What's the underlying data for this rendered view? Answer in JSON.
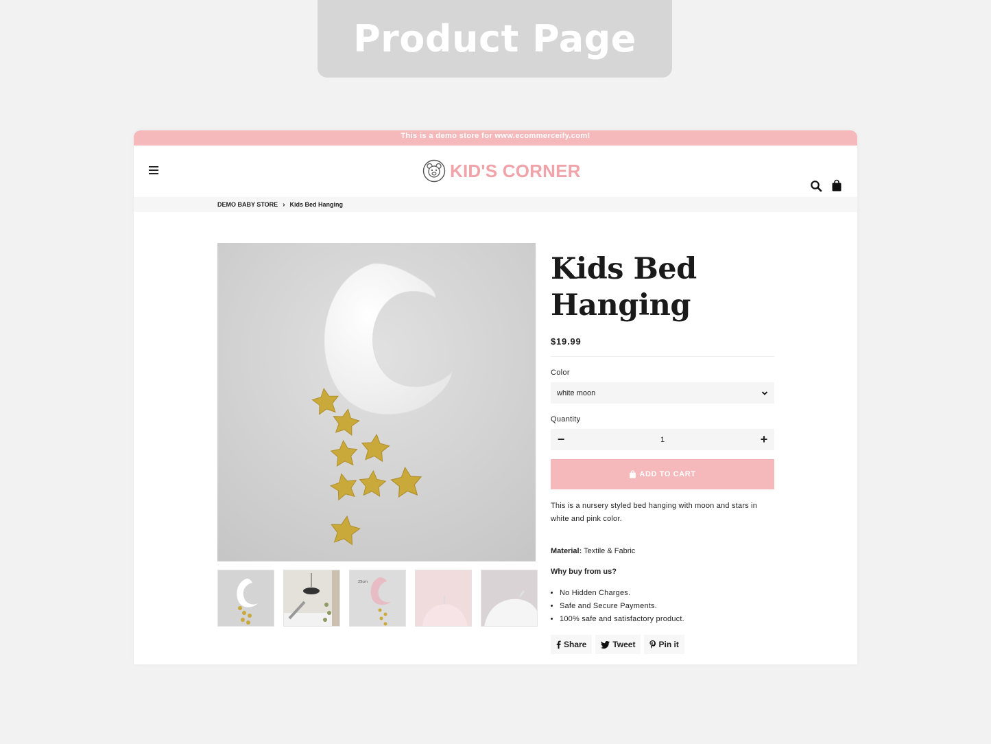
{
  "hero": {
    "label": "Product Page"
  },
  "announcement": {
    "text": "This is a demo store for www.ecommerceify.com!"
  },
  "header": {
    "brand": "KID'S CORNER",
    "icons": [
      "menu-icon",
      "bear-logo-icon",
      "search-icon",
      "bag-icon"
    ]
  },
  "breadcrumb": {
    "home": "DEMO BABY STORE",
    "current": "Kids Bed Hanging"
  },
  "product": {
    "title_line1": "Kids Bed",
    "title_line2": "Hanging",
    "price": "$19.99",
    "color_label": "Color",
    "color_value": "white moon",
    "quantity_label": "Quantity",
    "quantity_value": "1",
    "add_to_cart": "ADD TO CART",
    "description": "This is a nursery styled bed hanging with moon and stars in white and pink color.",
    "material_label": "Material:",
    "material_value": "Textile & Fabric",
    "why_heading": "Why buy from us?",
    "bullets": [
      "No Hidden Charges.",
      "Safe and Secure Payments.",
      "100% safe and satisfactory product."
    ],
    "thumb_size_text": "25cm"
  },
  "share": {
    "share": "Share",
    "tweet": "Tweet",
    "pin": "Pin it"
  },
  "colors": {
    "accent": "#f5b8bb",
    "brand": "#f0a3a8",
    "star": "#c9a93a"
  }
}
